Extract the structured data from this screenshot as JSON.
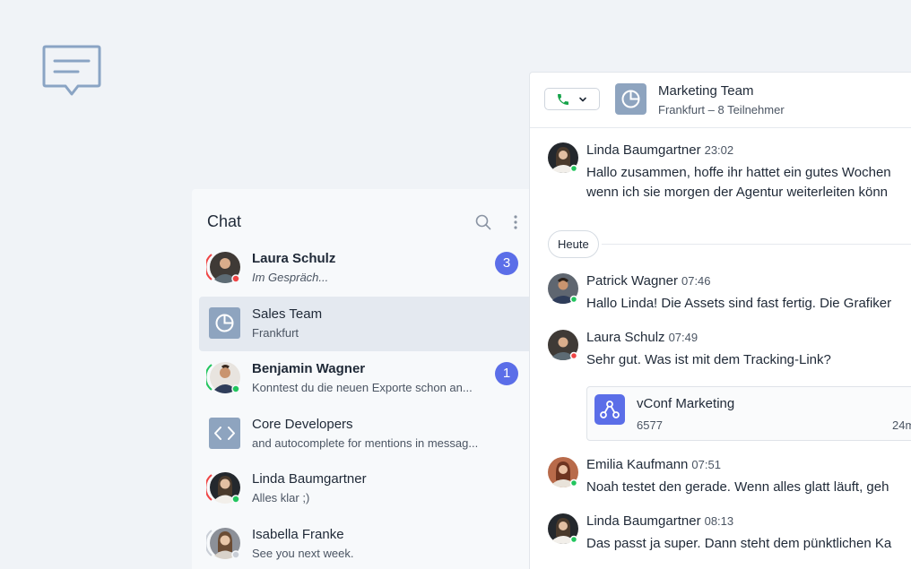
{
  "chat": {
    "title": "Chat",
    "items": [
      {
        "name": "Laura Schulz",
        "subtitle": "Im Gespräch...",
        "badge": "3",
        "status": "busy"
      },
      {
        "name": "Sales Team",
        "subtitle": "Frankfurt",
        "badge": "",
        "status": ""
      },
      {
        "name": "Benjamin Wagner",
        "subtitle": "Konntest du die neuen Exporte schon an...",
        "badge": "1",
        "status": "online"
      },
      {
        "name": "Core Developers",
        "subtitle": "and autocomplete for mentions in messag...",
        "badge": "",
        "status": ""
      },
      {
        "name": "Linda Baumgartner",
        "subtitle": "Alles klar ;)",
        "badge": "",
        "status": "online"
      },
      {
        "name": "Isabella Franke",
        "subtitle": "See you next week.",
        "badge": "",
        "status": "away"
      }
    ]
  },
  "conversation": {
    "title": "Marketing Team",
    "subtitle": "Frankfurt – 8 Teilnehmer",
    "divider": "Heute",
    "messages": [
      {
        "author": "Linda Baumgartner",
        "time": "23:02",
        "line1": "Hallo zusammen, hoffe ihr hattet ein gutes Wochen",
        "line2": "wenn ich sie morgen der Agentur weiterleiten könn"
      },
      {
        "author": "Patrick Wagner",
        "time": "07:46",
        "line1": "Hallo Linda! Die Assets sind fast fertig. Die Grafiker"
      },
      {
        "author": "Laura Schulz",
        "time": "07:49",
        "line1": "Sehr gut. Was ist mit dem Tracking-Link?"
      },
      {
        "author": "Emilia Kaufmann",
        "time": "07:51",
        "line1": "Noah testet den gerade. Wenn alles glatt läuft, geh"
      },
      {
        "author": "Linda Baumgartner",
        "time": "08:13",
        "line1": "Das passt ja super. Dann steht dem pünktlichen Ka"
      }
    ],
    "attachment": {
      "title": "vConf Marketing",
      "count": "6577",
      "age": "24m"
    }
  },
  "colors": {
    "accent": "#5b6ee8",
    "online": "#22c55e",
    "busy": "#ef4444",
    "away": "#c9ced6",
    "group_tile": "#8ea4bf"
  }
}
